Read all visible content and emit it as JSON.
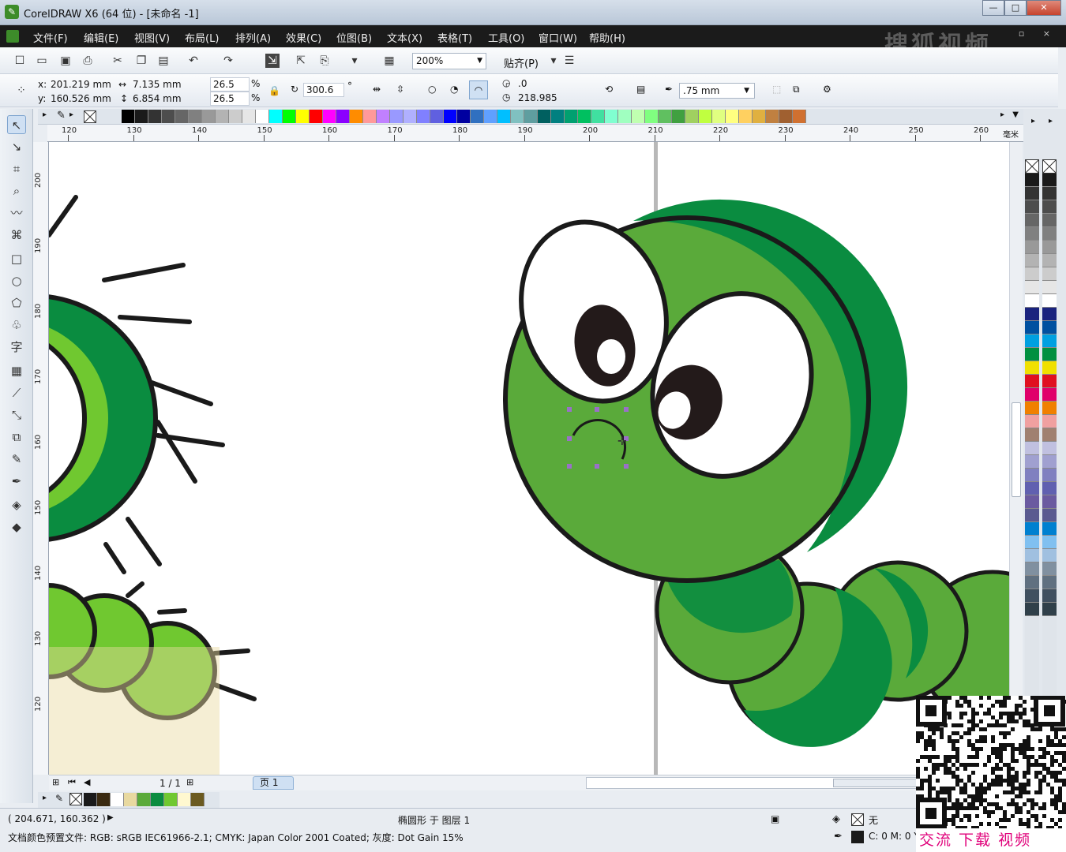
{
  "window": {
    "title": "CorelDRAW X6 (64 位) - [未命名 -1]",
    "minimize": "—",
    "maximize": "□",
    "close": "✕"
  },
  "menu": {
    "items": [
      "文件(F)",
      "编辑(E)",
      "视图(V)",
      "布局(L)",
      "排列(A)",
      "效果(C)",
      "位图(B)",
      "文本(X)",
      "表格(T)",
      "工具(O)",
      "窗口(W)",
      "帮助(H)"
    ],
    "mdi_buttons": "▫ ×",
    "watermark": "搜狐视频"
  },
  "toolbar": {
    "zoom_value": "200%",
    "snap_label": "贴齐(P)"
  },
  "property_bar": {
    "x_label": "x:",
    "x_value": "201.219 mm",
    "y_label": "y:",
    "y_value": "160.526 mm",
    "width_value": "7.135 mm",
    "height_value": "6.854 mm",
    "scale_x": "26.5",
    "scale_y": "26.5",
    "percent_sign": "%",
    "rotation": "300.6",
    "degree_sign": "°",
    "start_angle": ".0",
    "end_angle": "218.985",
    "outline_width": ".75 mm"
  },
  "ruler": {
    "h_labels": [
      "120",
      "130",
      "140",
      "150",
      "160",
      "170",
      "180",
      "190",
      "200",
      "210",
      "220",
      "230",
      "240",
      "250",
      "260"
    ],
    "v_labels": [
      "200",
      "190",
      "180",
      "170",
      "160",
      "150",
      "140",
      "130",
      "120"
    ],
    "unit": "毫米"
  },
  "palette": {
    "colors": [
      "#000000",
      "#1a1a1a",
      "#333333",
      "#4d4d4d",
      "#666666",
      "#808080",
      "#999999",
      "#b3b3b3",
      "#cccccc",
      "#e6e6e6",
      "#ffffff",
      "#00ffff",
      "#00ff00",
      "#ffff00",
      "#ff0000",
      "#ff00ff",
      "#8b00ff",
      "#ff8c00",
      "#ff9999",
      "#c080ff",
      "#9999ff",
      "#b0b0ff",
      "#8080ff",
      "#6060e0",
      "#0000ff",
      "#0000a0",
      "#3070c0",
      "#60a0ff",
      "#00bfff",
      "#80c0c0",
      "#5f9ea0",
      "#006060",
      "#008080",
      "#00a070",
      "#00c060",
      "#40e0a0",
      "#80ffd0",
      "#a0ffc0",
      "#c0ffb0",
      "#80ff80",
      "#60c060",
      "#40a040",
      "#a0d060",
      "#c0ff40",
      "#e0ff80",
      "#ffff80",
      "#ffd060",
      "#e0b040",
      "#c08040",
      "#a06030",
      "#d07030"
    ]
  },
  "canvas": {
    "caterpillar_green": "#5aaa3a",
    "caterpillar_dark": "#0a8c40",
    "caterpillar_light": "#70c830",
    "outline": "#1a1a1a"
  },
  "page_nav": {
    "count": "1 / 1",
    "tab": "页 1"
  },
  "status": {
    "coords": "( 204.671, 160.362 )",
    "object": "椭圆形 于 图层 1",
    "profile": "文档颜色预置文件: RGB: sRGB IEC61966-2.1; CMYK: Japan Color 2001 Coated; 灰度: Dot Gain 15%",
    "fill": "无",
    "outline": "C: 0 M: 0 Y:"
  },
  "qr_caption": "交流 下载 视频"
}
